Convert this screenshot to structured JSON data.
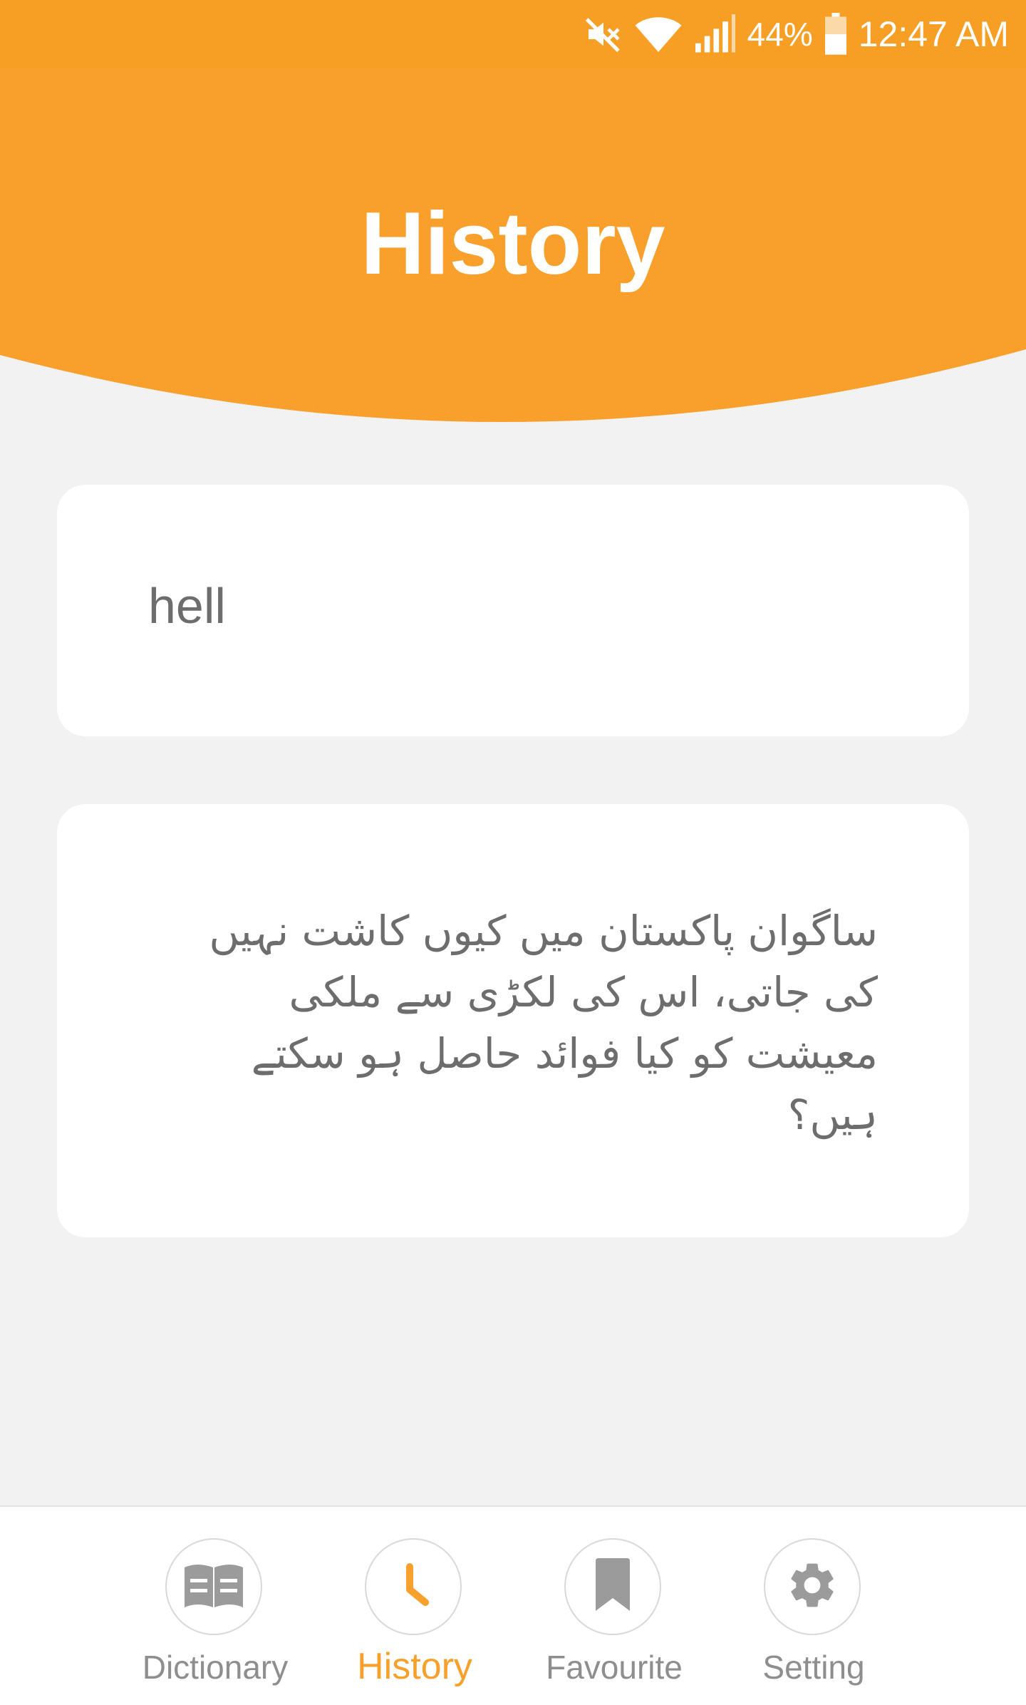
{
  "status_bar": {
    "battery": "44%",
    "time": "12:47 AM"
  },
  "header": {
    "title": "History",
    "color": "#f8a02b"
  },
  "history_items": [
    {
      "text": "hell"
    },
    {
      "text": "ساگوان پاکستان میں کیوں کاشت نہیں کی جاتی، اس کی لکڑی سے ملکی معیشت کو کیا فوائد حاصل ہو سکتے ہیں؟"
    }
  ],
  "bottom_nav": {
    "items": [
      {
        "label": "Dictionary",
        "icon": "book-icon",
        "active": false
      },
      {
        "label": "History",
        "icon": "clock-icon",
        "active": true
      },
      {
        "label": "Favourite",
        "icon": "bookmark-icon",
        "active": false
      },
      {
        "label": "Setting",
        "icon": "gear-icon",
        "active": false
      }
    ],
    "active_color": "#f7a02b",
    "inactive_color": "#8e8e8e"
  }
}
